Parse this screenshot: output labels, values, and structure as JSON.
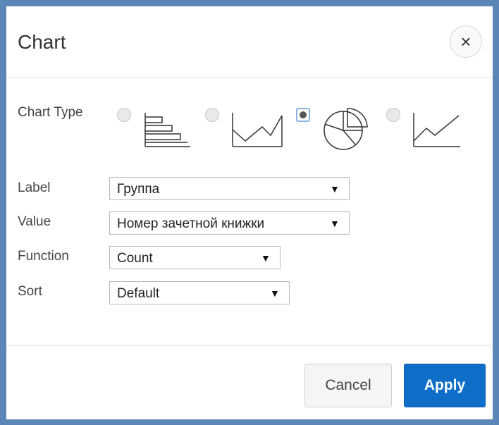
{
  "dialog": {
    "title": "Chart",
    "close_icon": "close-icon",
    "close_glyph": "×"
  },
  "chart_type": {
    "label": "Chart Type",
    "options": [
      {
        "icon": "horizontal-bar-chart-icon",
        "selected": false
      },
      {
        "icon": "area-chart-icon",
        "selected": false
      },
      {
        "icon": "pie-chart-icon",
        "selected": true
      },
      {
        "icon": "line-chart-icon",
        "selected": false
      }
    ]
  },
  "fields": {
    "label": {
      "label": "Label",
      "value": "Группа"
    },
    "value": {
      "label": "Value",
      "value": "Номер зачетной книжки"
    },
    "function": {
      "label": "Function",
      "value": "Count"
    },
    "sort": {
      "label": "Sort",
      "value": "Default"
    }
  },
  "dropdown_arrow": "▼",
  "footer": {
    "cancel_label": "Cancel",
    "apply_label": "Apply"
  },
  "colors": {
    "frame": "#5b86b8",
    "apply_button": "#0e6ec8"
  }
}
